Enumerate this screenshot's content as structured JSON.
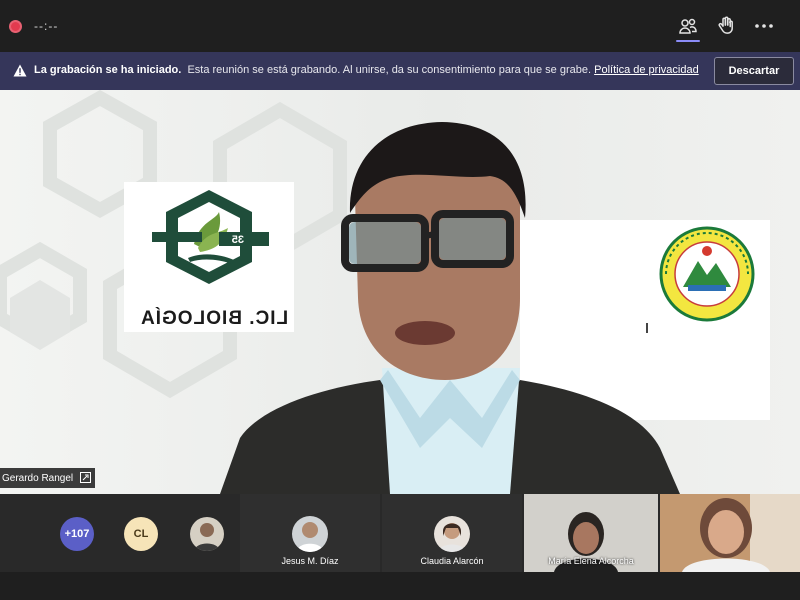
{
  "top_bar": {
    "timer": "--:--",
    "icons": [
      "participants-icon",
      "raise-hand-icon",
      "more-options-icon"
    ]
  },
  "banner": {
    "title": "La grabación se ha iniciado.",
    "message": "Esta reunión se está grabando. Al unirse, da su consentimiento para que se grabe.",
    "link": "Política de privacidad",
    "dismiss": "Descartar"
  },
  "main_video": {
    "speaker_name": "Gerardo Rangel",
    "logo_text": "LIC. BIOLOGÍA",
    "logo_number": "35"
  },
  "gallery": {
    "overflow_count": "+107",
    "initials": "CL",
    "tiles": [
      {
        "name": "Jesus M. Díaz"
      },
      {
        "name": "Claudia Alarcón"
      },
      {
        "name": "María Elena Alcorcha"
      }
    ]
  },
  "colors": {
    "accent": "#8b8cf7",
    "banner_bg": "#35365a",
    "record_red": "#e23a4f"
  }
}
